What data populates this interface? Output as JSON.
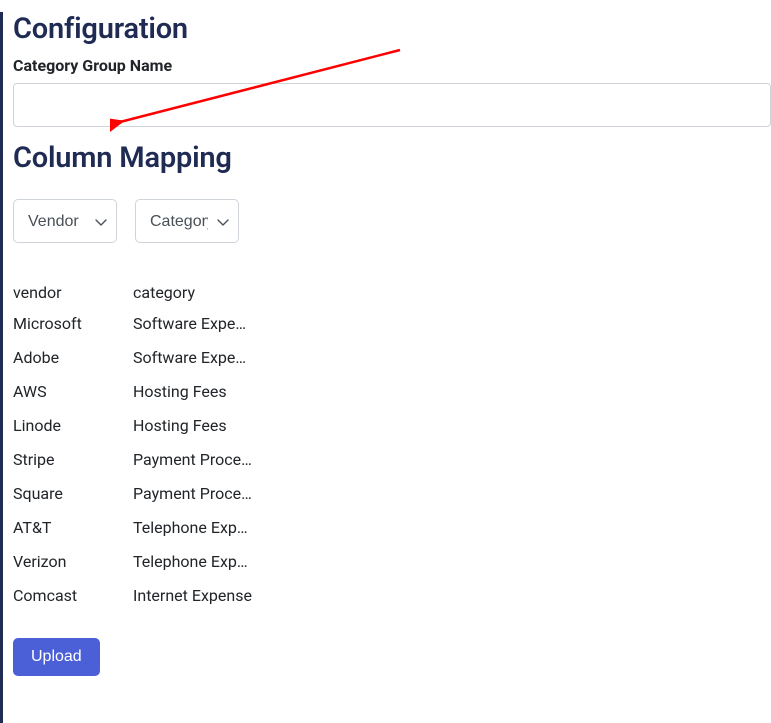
{
  "headings": {
    "configuration": "Configuration",
    "column_mapping": "Column Mapping"
  },
  "form": {
    "category_group_label": "Category Group Name",
    "category_group_value": ""
  },
  "selects": {
    "vendor": {
      "selected": "Vendor"
    },
    "category": {
      "selected": "Category"
    }
  },
  "table": {
    "headers": {
      "vendor": "vendor",
      "category": "category"
    },
    "rows": [
      {
        "vendor": "Microsoft",
        "category": "Software Expense"
      },
      {
        "vendor": "Adobe",
        "category": "Software Expense"
      },
      {
        "vendor": "AWS",
        "category": "Hosting Fees"
      },
      {
        "vendor": "Linode",
        "category": "Hosting Fees"
      },
      {
        "vendor": "Stripe",
        "category": "Payment Processing"
      },
      {
        "vendor": "Square",
        "category": "Payment Processing"
      },
      {
        "vendor": "AT&T",
        "category": "Telephone Expense"
      },
      {
        "vendor": "Verizon",
        "category": "Telephone Expense"
      },
      {
        "vendor": "Comcast",
        "category": "Internet Expense"
      }
    ]
  },
  "buttons": {
    "upload": "Upload"
  },
  "annotation": {
    "arrow_color": "#ff0000"
  }
}
